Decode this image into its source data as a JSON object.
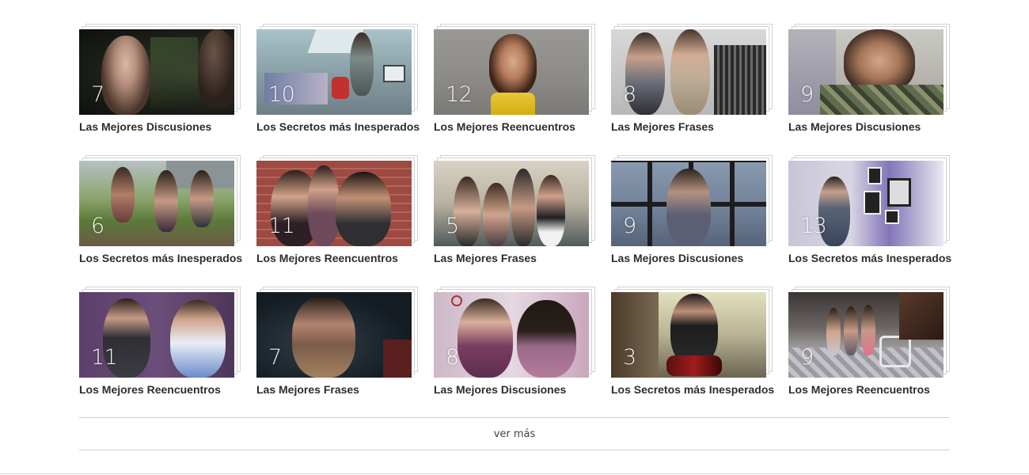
{
  "grid": {
    "items": [
      {
        "count": "7",
        "title": "Las Mejores Discusiones",
        "scene": "dark-forest"
      },
      {
        "count": "10",
        "title": "Los Secretos más Inesperados",
        "scene": "attic-room"
      },
      {
        "count": "12",
        "title": "Los Mejores Reencuentros",
        "scene": "grey-portrait"
      },
      {
        "count": "8",
        "title": "Las Mejores Frases",
        "scene": "indoor-group"
      },
      {
        "count": "9",
        "title": "Las Mejores Discusiones",
        "scene": "camo-closeup"
      },
      {
        "count": "6",
        "title": "Los Secretos más Inesperados",
        "scene": "park-bench"
      },
      {
        "count": "11",
        "title": "Los Mejores Reencuentros",
        "scene": "brick-wall"
      },
      {
        "count": "5",
        "title": "Las Mejores Frases",
        "scene": "pool-group"
      },
      {
        "count": "9",
        "title": "Las Mejores Discusiones",
        "scene": "rainy-window"
      },
      {
        "count": "13",
        "title": "Los Secretos más Inesperados",
        "scene": "gallery-room"
      },
      {
        "count": "11",
        "title": "Los Mejores Reencuentros",
        "scene": "purple-office"
      },
      {
        "count": "7",
        "title": "Las Mejores Frases",
        "scene": "dark-closeup"
      },
      {
        "count": "8",
        "title": "Las Mejores Discusiones",
        "scene": "pink-room"
      },
      {
        "count": "3",
        "title": "Los Secretos más Inesperados",
        "scene": "motorbike"
      },
      {
        "count": "9",
        "title": "Los Mejores Reencuentros",
        "scene": "staircase-hall"
      }
    ]
  },
  "more": {
    "label": "ver más"
  },
  "colors": {
    "title_text": "#2d2d2d",
    "border": "#cfcfcf",
    "count_text": "#ffffff"
  }
}
